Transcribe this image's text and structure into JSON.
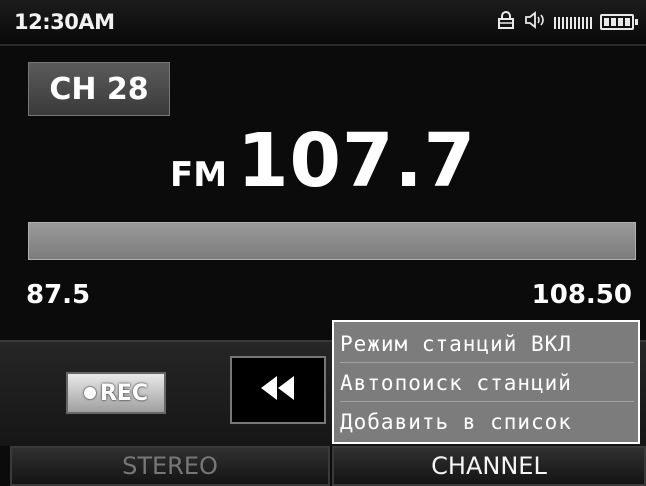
{
  "status": {
    "time": "12:30AM",
    "icons": [
      "lock-icon",
      "volume-icon",
      "signal-icon",
      "battery-icon"
    ]
  },
  "channel": {
    "label": "CH 28"
  },
  "frequency": {
    "band": "FM",
    "value": "107.7"
  },
  "tuner": {
    "min_label": "87.5",
    "max_label": "108.50",
    "position_fraction": 0.0
  },
  "controls": {
    "rec_label": "REC"
  },
  "menu": {
    "items": [
      "Режим станций ВКЛ",
      "Автопоиск станций",
      "Добавить в список"
    ]
  },
  "tabs": {
    "stereo": "STEREO",
    "channel": "CHANNEL"
  },
  "colors": {
    "background": "#0b0b0b",
    "panel": "#7c7c7c",
    "text": "#ffffff"
  }
}
